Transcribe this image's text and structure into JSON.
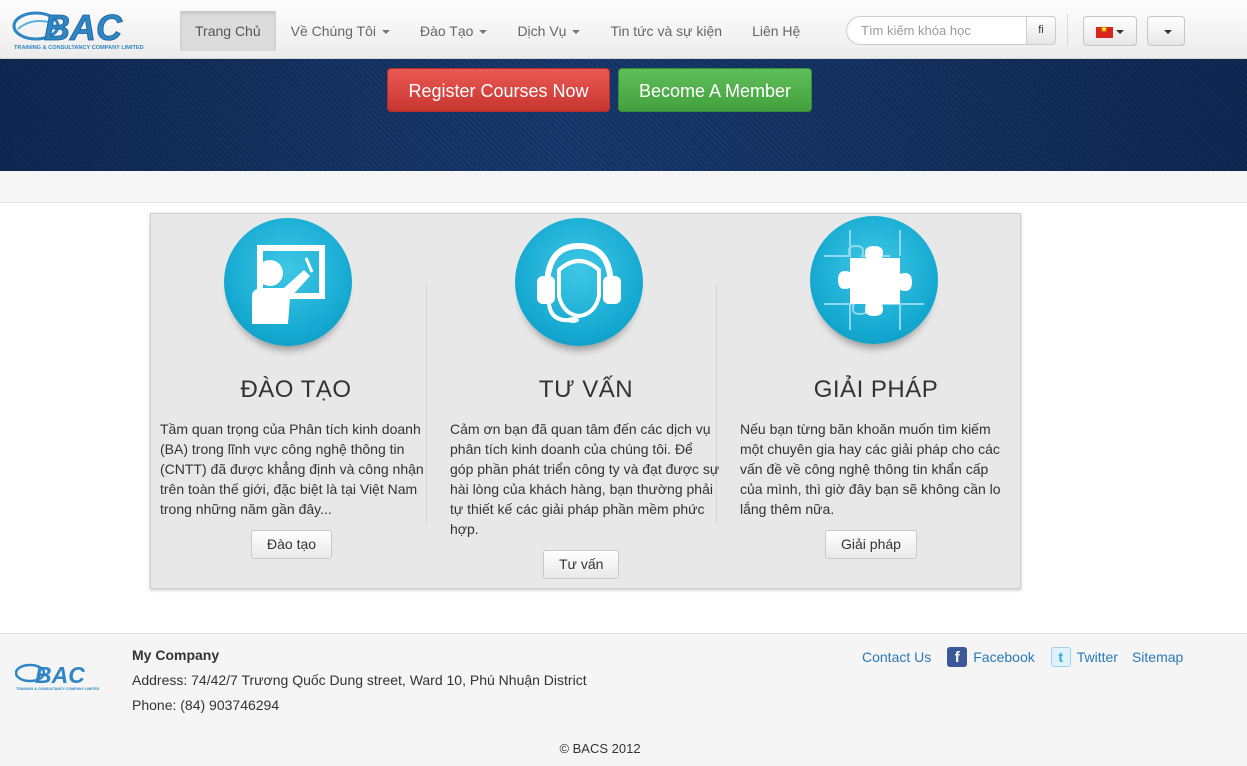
{
  "brand": {
    "logo_text": "BAC",
    "logo_subtext": "TRAINING & CONSULTANCY COMPANY LIMITED"
  },
  "nav": {
    "items": [
      {
        "label": "Trang Chủ",
        "active": true,
        "dropdown": false
      },
      {
        "label": "Về Chúng Tôi",
        "active": false,
        "dropdown": true
      },
      {
        "label": "Đào Tạo",
        "active": false,
        "dropdown": true
      },
      {
        "label": "Dịch Vụ",
        "active": false,
        "dropdown": true
      },
      {
        "label": "Tin tức và sự kiện",
        "active": false,
        "dropdown": false
      },
      {
        "label": "Liên Hệ",
        "active": false,
        "dropdown": false
      }
    ],
    "search_placeholder": "Tìm kiếm khóa học",
    "search_button": "fi",
    "language_flag": "vn-flag-icon"
  },
  "hero": {
    "register_label": "Register Courses Now",
    "member_label": "Become A Member",
    "colors": {
      "register": "#d9453f",
      "member": "#52b04c",
      "background": "#14315f"
    }
  },
  "features": [
    {
      "title": "ĐÀO TẠO",
      "text": "Tầm quan trọng của Phân tích kinh doanh (BA) trong lĩnh vực công nghệ thông tin (CNTT) đã được khẳng định và công nhận trên toàn thế giới, đặc biệt là tại Việt Nam trong những năm gần đây...",
      "button": "Đào tạo",
      "icon": "teacher-board-icon"
    },
    {
      "title": "TƯ VẤN",
      "text": "Cảm ơn bạn đã quan tâm đến các dịch vụ phân tích kinh doanh của chúng tôi. Để góp phần phát triển công ty và đạt được sự hài lòng của khách hàng, bạn thường phải tự thiết kế các giải pháp phần mềm phức hợp.",
      "button": "Tư vấn",
      "icon": "headset-icon"
    },
    {
      "title": "GIẢI PHÁP",
      "text": "Nếu bạn từng băn khoăn muốn tìm kiếm một chuyên gia hay các giải pháp cho các vấn đề về công nghệ thông tin khẩn cấp của mình, thì giờ đây bạn sẽ không cần lo lắng thêm nữa.",
      "button": "Giải pháp",
      "icon": "puzzle-icon"
    }
  ],
  "footer": {
    "company": "My Company",
    "address": "Address: 74/42/7 Trương Quốc Dung street, Ward 10, Phú Nhuận District",
    "phone": "Phone: (84) 903746294",
    "links": {
      "contact": "Contact Us",
      "facebook": "Facebook",
      "twitter": "Twitter",
      "sitemap": "Sitemap"
    },
    "copyright": "© BACS 2012",
    "link_color": "#2a7ab8"
  }
}
